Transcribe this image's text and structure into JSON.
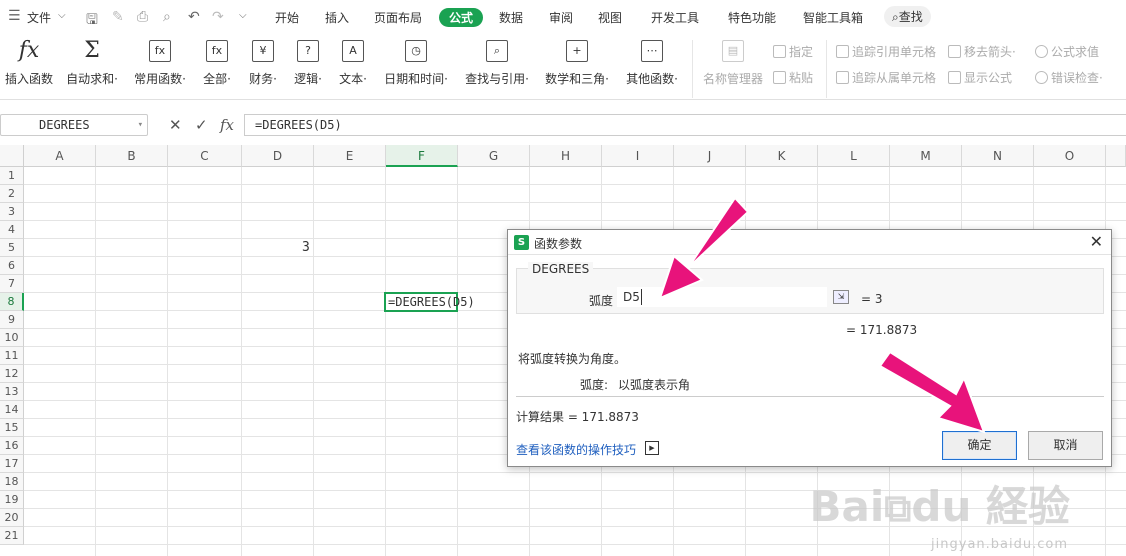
{
  "menubar": {
    "file_label": "文件",
    "tabs": [
      "开始",
      "插入",
      "页面布局",
      "公式",
      "数据",
      "审阅",
      "视图",
      "开发工具",
      "特色功能",
      "智能工具箱"
    ],
    "active_tab": "公式",
    "search_label": "查找"
  },
  "ribbon": {
    "big_buttons": [
      {
        "icon": "fx",
        "label": "插入函数"
      },
      {
        "icon": "Σ",
        "label": "自动求和·"
      },
      {
        "icon": "fx",
        "label": "常用函数·"
      },
      {
        "icon": "fx",
        "label": "全部·"
      },
      {
        "icon": "¥",
        "label": "财务·"
      },
      {
        "icon": "?",
        "label": "逻辑·"
      },
      {
        "icon": "A",
        "label": "文本·"
      },
      {
        "icon": "◷",
        "label": "日期和时间·"
      },
      {
        "icon": "⌕",
        "label": "查找与引用·"
      },
      {
        "icon": "+",
        "label": "数学和三角·"
      },
      {
        "icon": "⋯",
        "label": "其他函数·"
      }
    ],
    "name_manager": "名称管理器",
    "define": "指定",
    "paste": "粘贴",
    "trace_precedents": "追踪引用单元格",
    "trace_dependents": "追踪从属单元格",
    "remove_arrows": "移去箭头·",
    "show_formulas": "显示公式",
    "evaluate": "公式求值",
    "error_check": "错误检查·"
  },
  "formula_bar": {
    "name_box": "DEGREES",
    "cancel_icon": "✕",
    "enter_icon": "✓",
    "fx_label": "fx",
    "formula": "=DEGREES(D5)"
  },
  "grid": {
    "columns": [
      "A",
      "B",
      "C",
      "D",
      "E",
      "F",
      "G",
      "H",
      "I",
      "J",
      "K",
      "L",
      "M",
      "N",
      "O"
    ],
    "selected_column": "F",
    "rows": [
      "1",
      "2",
      "3",
      "4",
      "5",
      "6",
      "7",
      "8",
      "9",
      "10",
      "11",
      "12",
      "13",
      "14",
      "15",
      "16",
      "17",
      "18",
      "19",
      "20",
      "21"
    ],
    "selected_row": "8",
    "cells": {
      "D5": "3",
      "F8": "=DEGREES(D5)"
    }
  },
  "dialog": {
    "title": "函数参数",
    "function_name": "DEGREES",
    "arg_label": "弧度",
    "arg_value": "D5",
    "arg_result": "= 3",
    "result_line": "= 171.8873",
    "description": "将弧度转换为角度。",
    "arg_desc_label": "弧度:",
    "arg_desc_text": "以弧度表示角",
    "calc_result": "计算结果 = 171.8873",
    "help_link": "查看该函数的操作技巧",
    "ok": "确定",
    "cancel": "取消",
    "close": "✕"
  },
  "colors": {
    "accent": "#1aa252",
    "arrow": "#e8137b",
    "link": "#1f5fbf"
  },
  "watermark": {
    "text": "Bai経验",
    "sub": "jingyan.baidu.com"
  }
}
